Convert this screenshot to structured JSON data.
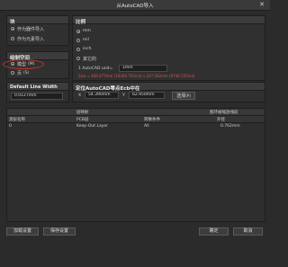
{
  "window": {
    "title": "从AutoCAD导入",
    "close_glyph": "✕"
  },
  "block_panel": {
    "header": "块",
    "options": [
      {
        "label": "作为器件导入",
        "checked": true
      },
      {
        "label": "作为元素导入",
        "checked": false
      }
    ]
  },
  "scale_panel": {
    "header": "比例",
    "units": [
      {
        "label": "mm",
        "checked": true
      },
      {
        "label": "mil",
        "checked": false
      },
      {
        "label": "inch",
        "checked": false
      },
      {
        "label": "其它的",
        "checked": false
      }
    ],
    "autocad_unit_label": "1 AutoCAD unit=",
    "autocad_unit_value": "1mm",
    "size_info": "Size = 466.077mm (18349.705mil) x 247.582mm (9746.555mil)"
  },
  "draw_space_panel": {
    "header": "绘制空间",
    "options": [
      {
        "label": "模型",
        "suffix": "(M)",
        "checked": true
      },
      {
        "label": "页",
        "suffix": "(S)",
        "checked": false
      }
    ]
  },
  "line_width_panel": {
    "header": "Default Line Width",
    "value": "0.0127mm"
  },
  "locate_panel": {
    "header": "定位AutoCAD零点Ecb中在",
    "x_label": "X",
    "x_value": "54.390mm",
    "y_label": "Y",
    "y_value": "62.950mm",
    "select_button": "选择",
    "select_suffix": "(P)"
  },
  "layer_table": {
    "group_headers": {
      "layer_map": "层映射",
      "width_convert": "图环被缩放线段"
    },
    "columns": [
      "源层名称",
      "PCB层",
      "转换条件",
      "外径"
    ],
    "rows": [
      {
        "source": "0",
        "pcb_layer": "Keep-Out Layer",
        "condition": "All",
        "width": "0.762mm"
      }
    ]
  },
  "footer": {
    "load_button": "加载设置",
    "save_button": "保存设置",
    "ok_button": "确定",
    "cancel_button": "取消"
  }
}
